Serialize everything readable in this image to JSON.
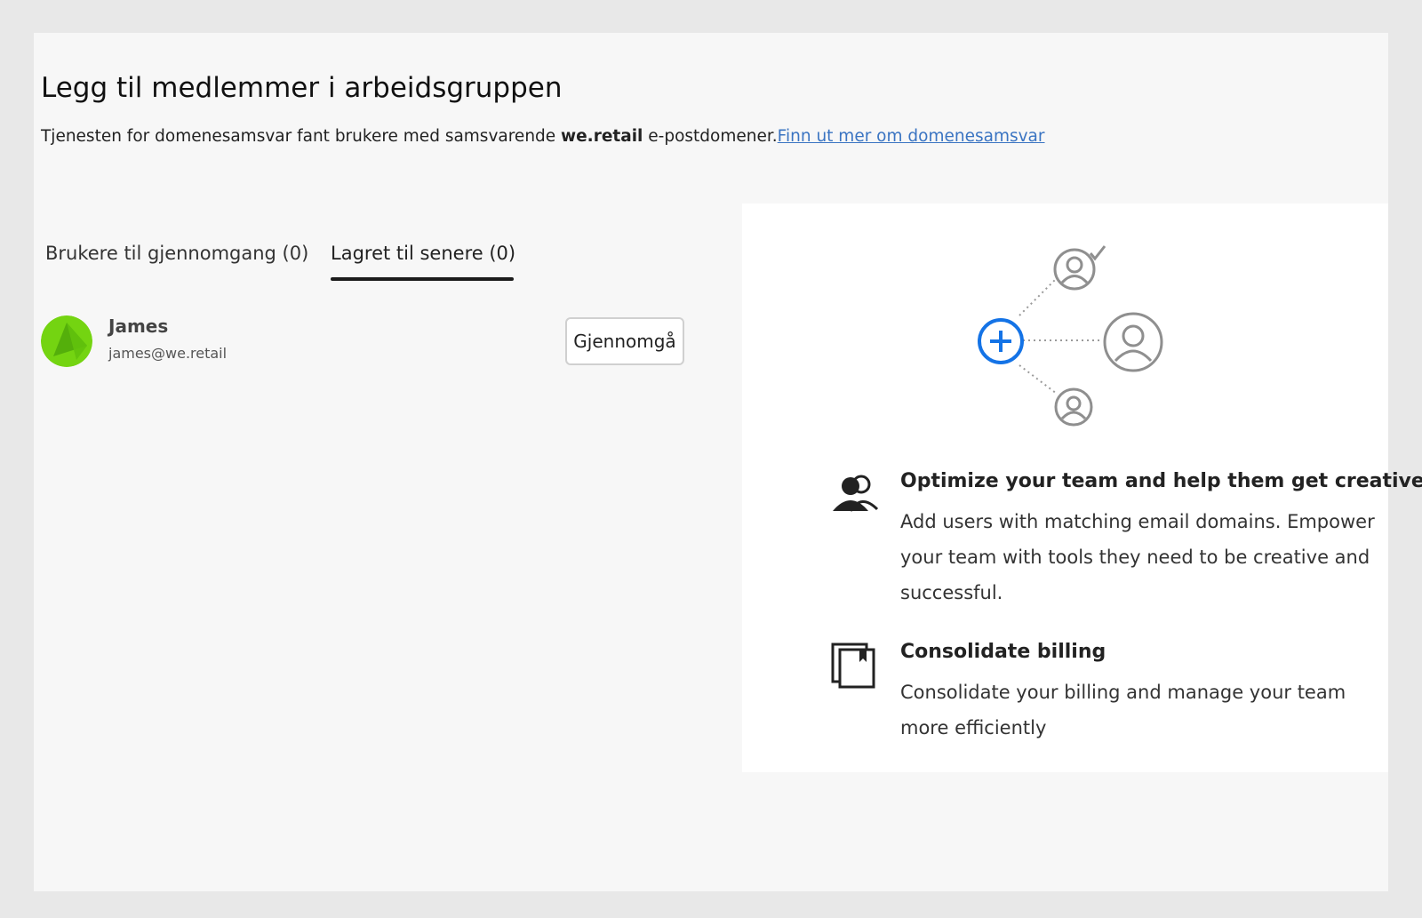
{
  "header": {
    "title": "Legg til medlemmer i arbeidsgruppen",
    "description_prefix": "Tjenesten for domenesamsvar fant brukere med samsvarende ",
    "domain": "we.retail",
    "description_suffix": " e-postdomener.",
    "learn_more_link": "Finn ut mer om domenesamsvar"
  },
  "tabs": [
    {
      "label": "Brukere til gjennomgang (0)",
      "active": false
    },
    {
      "label": "Lagret til senere (0)",
      "active": true
    }
  ],
  "users": [
    {
      "name": "James",
      "email": "james@we.retail",
      "avatar_color": "#6fce0c",
      "action_label": "Gjennomgå"
    }
  ],
  "info": {
    "accent_color": "#1473e6",
    "icons": [
      "add-circle-icon",
      "user-check-icon",
      "user-icon"
    ],
    "features": [
      {
        "icon": "people-icon",
        "title": "Optimize your team and help them get creative",
        "description": "Add users with matching email domains. Empower your team with tools they need to be creative and successful."
      },
      {
        "icon": "billing-icon",
        "title": "Consolidate billing",
        "description": "Consolidate your billing and manage your team more efficiently"
      }
    ]
  }
}
